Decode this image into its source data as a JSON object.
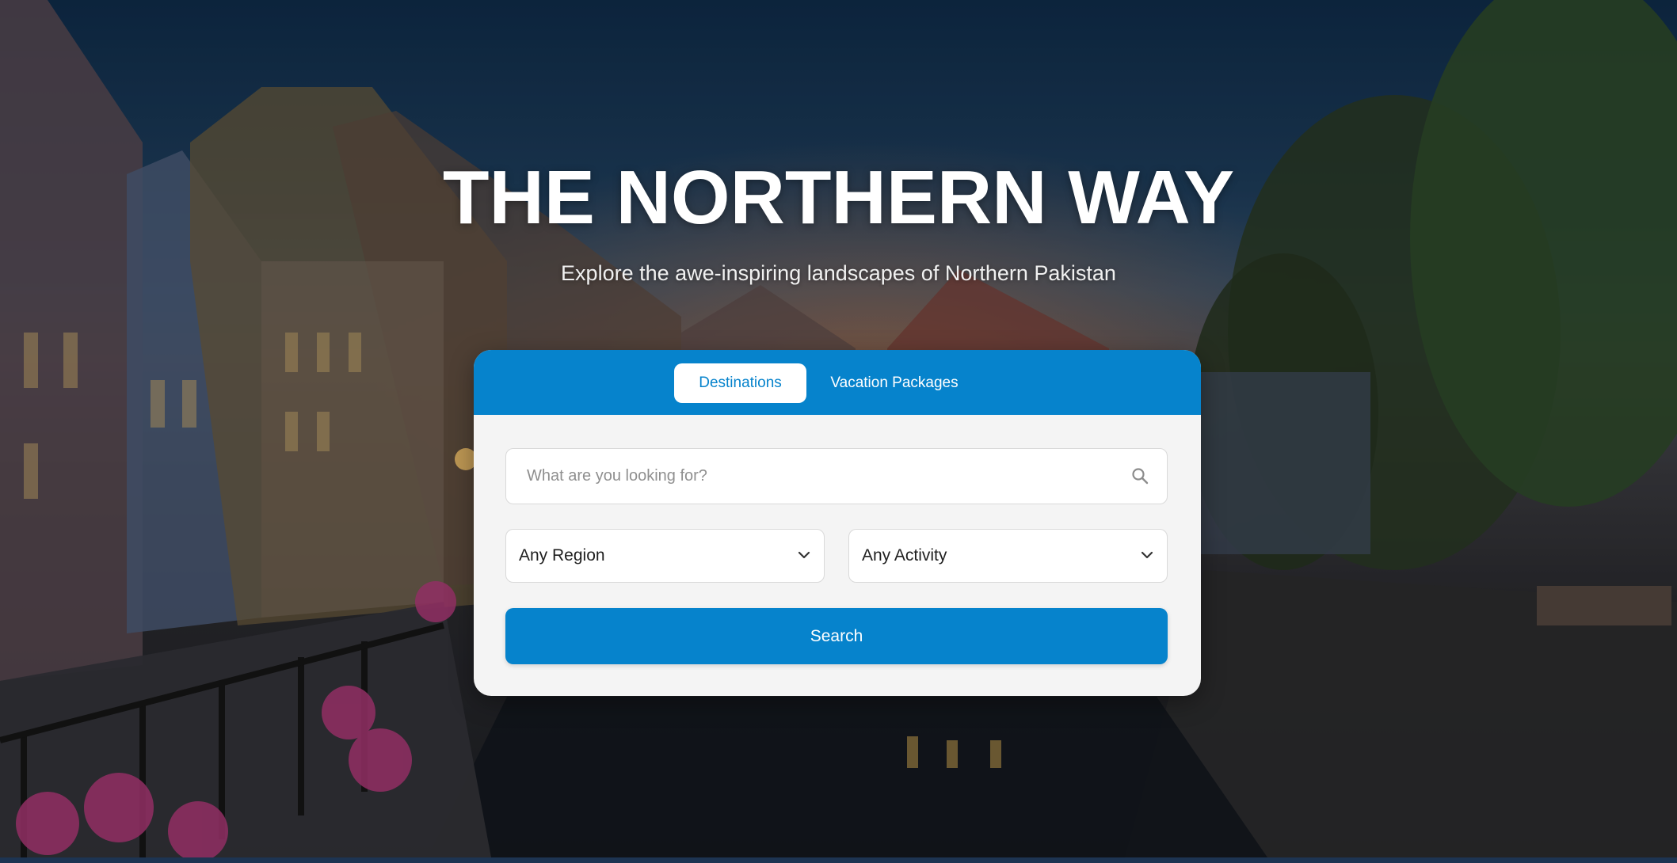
{
  "hero": {
    "title": "THE NORTHERN WAY",
    "subtitle": "Explore the awe-inspiring landscapes of Northern Pakistan",
    "background_image": "canal-town-at-dusk"
  },
  "search_card": {
    "tabs": [
      {
        "label": "Destinations",
        "active": true
      },
      {
        "label": "Vacation Packages",
        "active": false
      }
    ],
    "search": {
      "placeholder": "What are you looking for?",
      "value": "",
      "icon": "search-icon"
    },
    "filters": {
      "region": {
        "selected": "Any Region",
        "icon": "chevron-down-icon"
      },
      "activity": {
        "selected": "Any Activity",
        "icon": "chevron-down-icon"
      }
    },
    "button_label": "Search"
  },
  "colors": {
    "accent": "#0683cc",
    "card_background": "#f4f4f4",
    "title_text": "#ffffff"
  }
}
